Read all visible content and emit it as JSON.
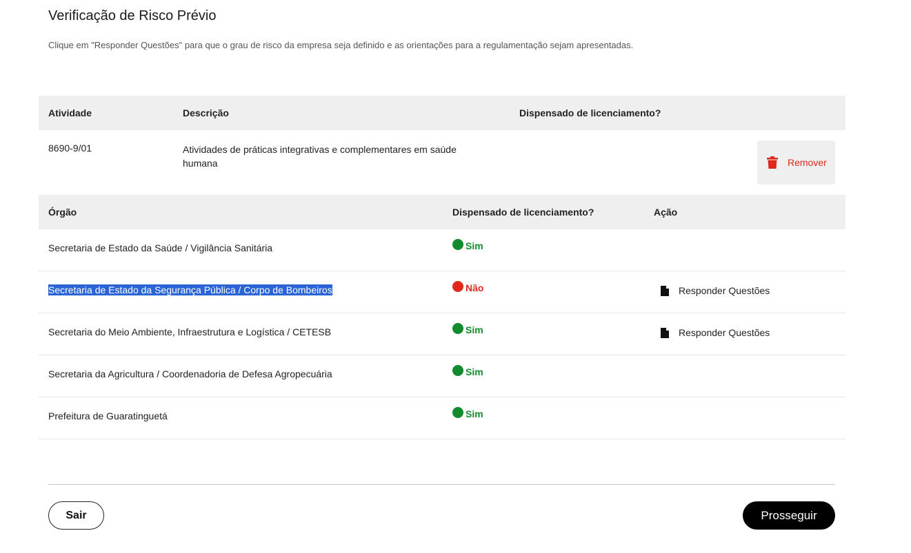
{
  "page": {
    "title": "Verificação de Risco Prévio",
    "subtitle": "Clique em  \"Responder Questões\" para que o grau de risco da empresa seja definido e as orientações para a regulamentação sejam apresentadas."
  },
  "activity_table": {
    "headers": {
      "activity": "Atividade",
      "description": "Descrição",
      "exempt": "Dispensado de licenciamento?"
    },
    "row": {
      "code": "8690-9/01",
      "description": "Atividades de práticas integrativas e complementares em saúde humana",
      "remove_label": "Remover"
    }
  },
  "organ_table": {
    "headers": {
      "organ": "Órgão",
      "exempt": "Dispensado de licenciamento?",
      "action": "Ação"
    },
    "rows": [
      {
        "organ": "Secretaria de Estado da Saúde / Vigilância Sanitária",
        "status": "Sim",
        "action": ""
      },
      {
        "organ": "Secretaria de Estado da Segurança Pública / Corpo de Bombeiros",
        "status": "Não",
        "action": "Responder Questões"
      },
      {
        "organ": "Secretaria do Meio Ambiente, Infraestrutura e Logística / CETESB",
        "status": "Sim",
        "action": "Responder Questões"
      },
      {
        "organ": "Secretaria da Agricultura / Coordenadoria de Defesa Agropecuária",
        "status": "Sim",
        "action": ""
      },
      {
        "organ": "Prefeitura de Guaratinguetá",
        "status": "Sim",
        "action": ""
      }
    ]
  },
  "footer": {
    "exit_label": "Sair",
    "proceed_label": "Prosseguir"
  },
  "icons": {
    "remove": "trash-icon",
    "respond": "document-icon",
    "status": "status-dot-icon"
  },
  "colors": {
    "yes": "#138a2e",
    "no": "#e0281c",
    "remove": "#e0281c",
    "selection": "#2a64d6",
    "header_bg": "#efefef"
  }
}
